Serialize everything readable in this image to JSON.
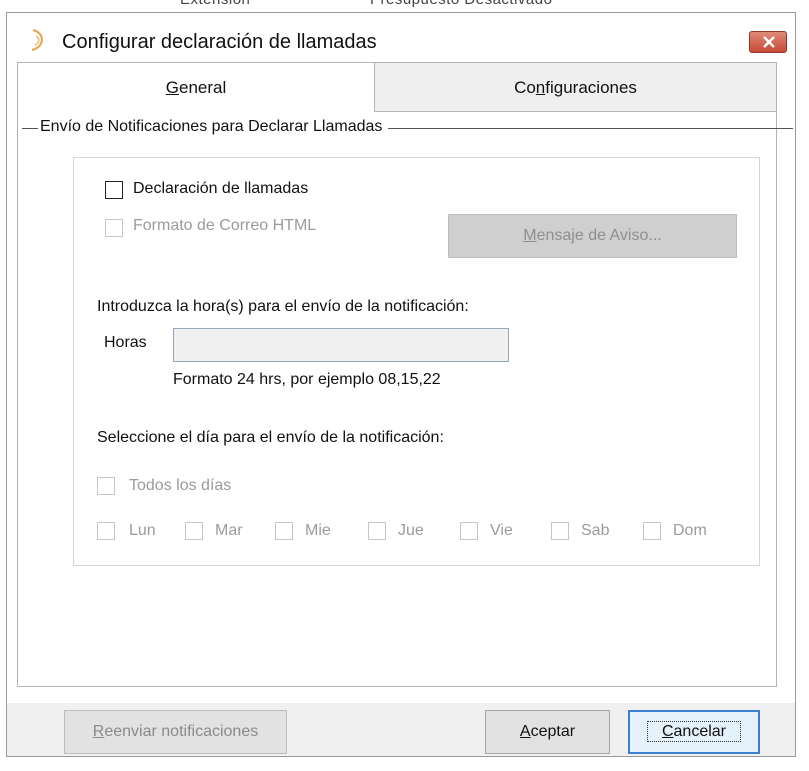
{
  "window": {
    "title": "Configurar declaración de llamadas",
    "close_icon": "close-x-icon"
  },
  "tabs": {
    "general": {
      "pre": "",
      "u": "G",
      "post": "eneral"
    },
    "config": {
      "pre": "Co",
      "u": "n",
      "post": "figuraciones"
    }
  },
  "group": {
    "title": "Envío de Notificaciones para Declarar Llamadas"
  },
  "options": {
    "declaracion": "Declaración de llamadas",
    "formato_html": "Formato de Correo HTML",
    "mensaje_aviso": {
      "pre": "",
      "u": "M",
      "post": "ensaje de Aviso..."
    }
  },
  "hours": {
    "prompt": "Introduzca la hora(s) para el envío de la notificación:",
    "label": "Horas",
    "value": "",
    "hint": "Formato 24 hrs, por ejemplo 08,15,22"
  },
  "days": {
    "prompt": "Seleccione el día para el envío de la notificación:",
    "all": "Todos los días",
    "list": [
      "Lun",
      "Mar",
      "Mie",
      "Jue",
      "Vie",
      "Sab",
      "Dom"
    ]
  },
  "buttons": {
    "reenviar": {
      "pre": "",
      "u": "R",
      "post": "eenviar notificaciones"
    },
    "aceptar": {
      "pre": "",
      "u": "A",
      "post": "ceptar"
    },
    "cancelar": {
      "pre": "",
      "u": "C",
      "post": "ancelar"
    }
  },
  "colors": {
    "close_button": "#c74a35",
    "focus_border": "#3c7fd0",
    "disabled_text": "#9b9b9b"
  }
}
